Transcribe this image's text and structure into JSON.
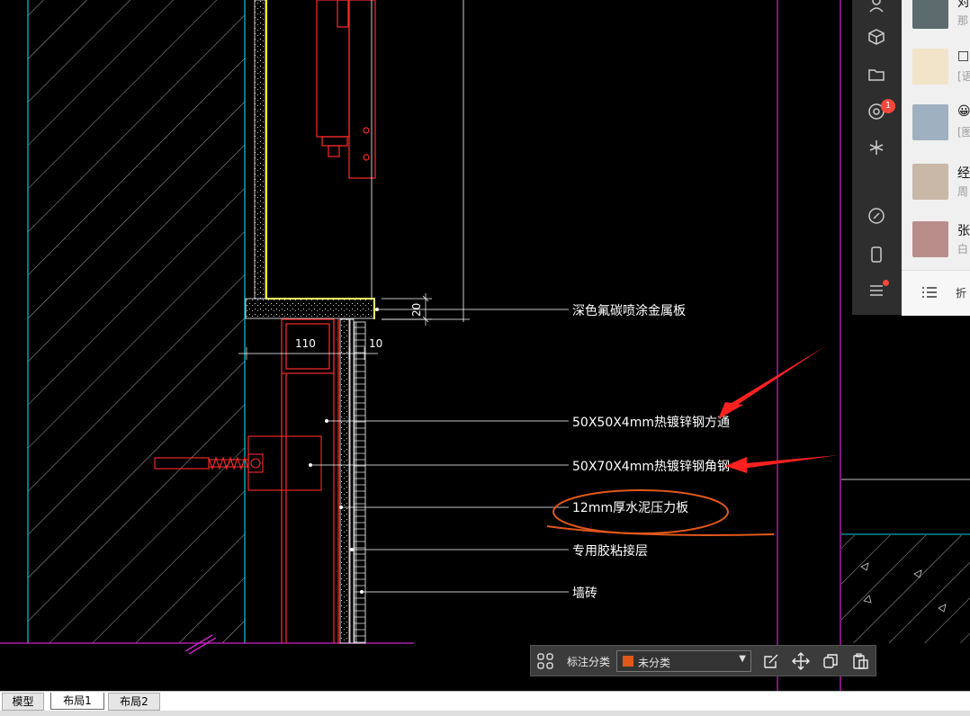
{
  "drawing": {
    "dim_110": "110",
    "dim_10": "10",
    "dim_20": "20",
    "callouts": [
      "深色氟碳喷涂金属板",
      "50X50X4mm热镀锌钢方通",
      "50X70X4mm热镀锌钢角钢",
      "12mm厚水泥压力板",
      "专用胶粘接层",
      "墙砖"
    ]
  },
  "chat": {
    "rail_icons": [
      "contacts-icon",
      "cube-icon",
      "folder-icon",
      "moments-icon",
      "star-icon",
      "link-icon",
      "phone-icon",
      "menu-icon"
    ],
    "badge": "1",
    "conversations": [
      {
        "title": "对",
        "sub": "那"
      },
      {
        "title": "□",
        "sub": "[语"
      },
      {
        "title": "😀",
        "sub": "[图"
      },
      {
        "title": "经",
        "sub": "周"
      },
      {
        "title": "张",
        "sub": "白"
      }
    ],
    "bottom_label": "折"
  },
  "annotation_bar": {
    "label": "标注分类",
    "value": "未分类",
    "swatch_color": "#e0581a"
  },
  "tabs": [
    "模型",
    "布局1",
    "布局2"
  ],
  "colors": {
    "cad_red": "#ff2a2a",
    "cad_yellow": "#ffff00",
    "cad_cyan": "#00cfd8",
    "cad_magenta": "#d020d0",
    "cad_white": "#ffffff",
    "markup_red": "#ff2020",
    "markup_orange": "#e0581a"
  }
}
